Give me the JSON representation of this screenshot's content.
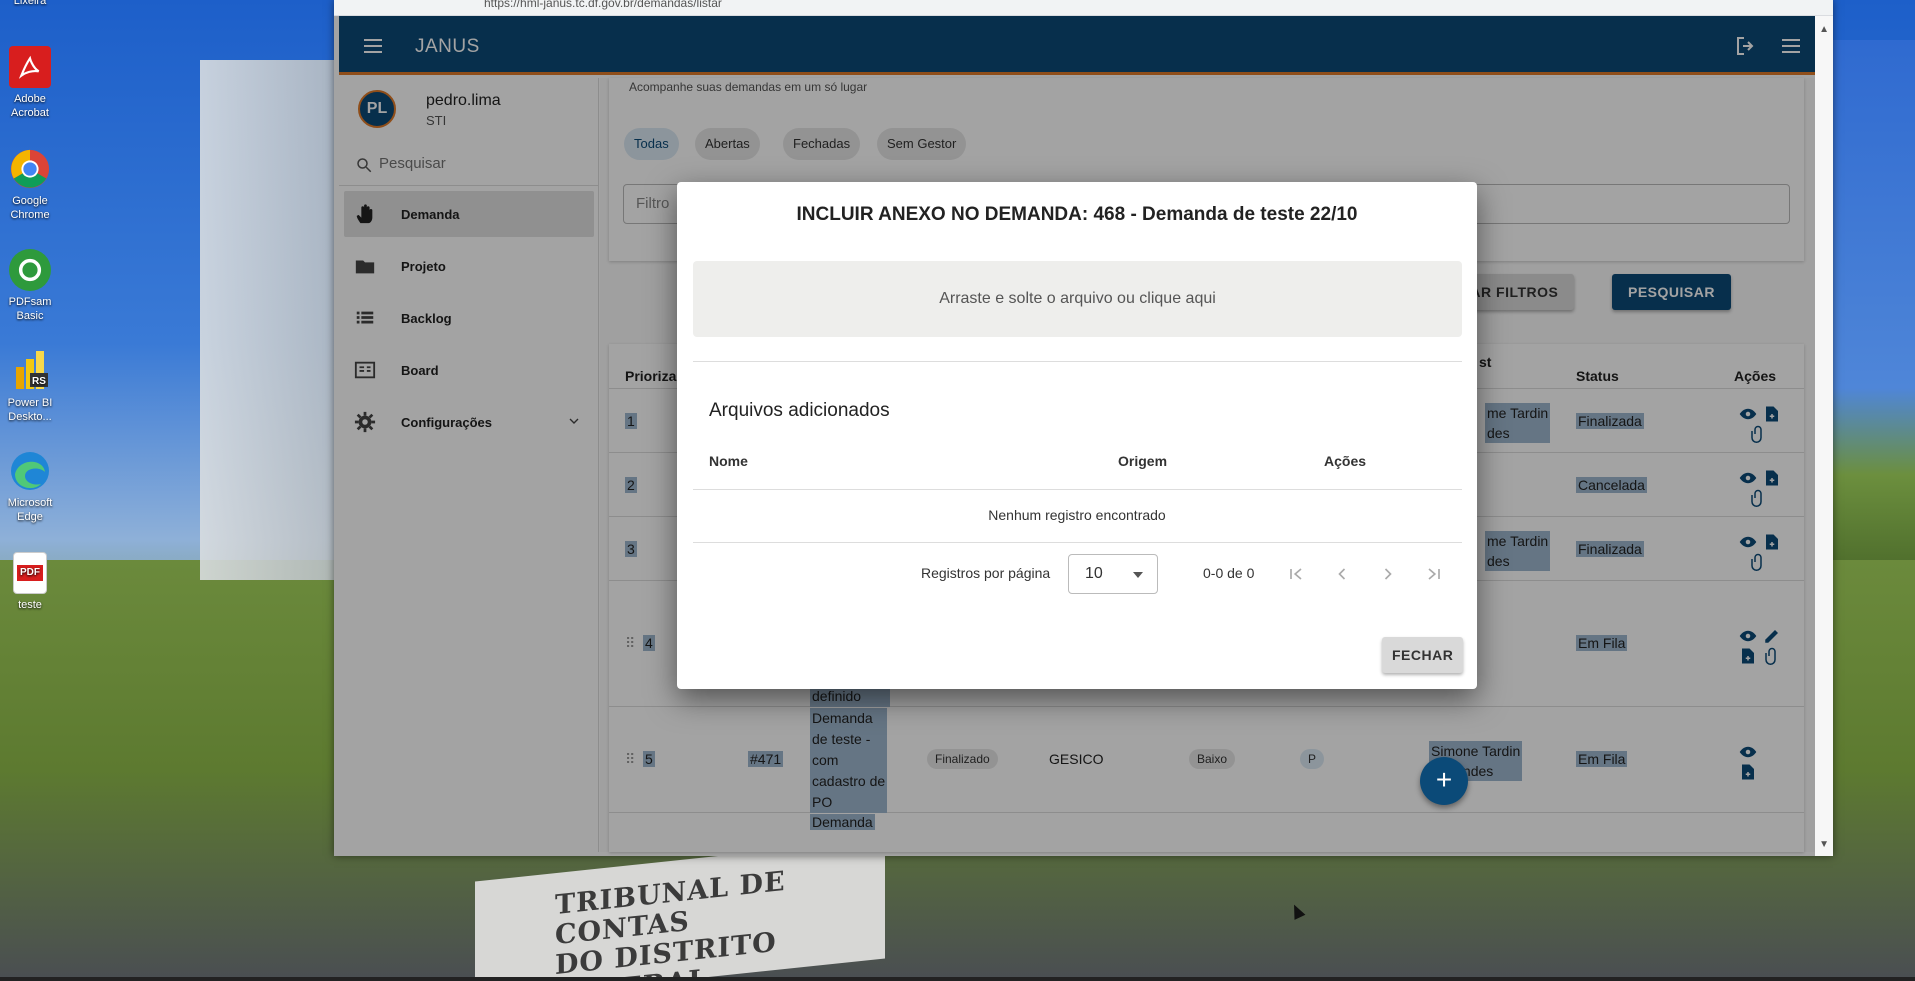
{
  "desktop": {
    "icons": [
      {
        "label": "Lixeira",
        "icon": "trash-icon",
        "color": "#2b6cc4"
      },
      {
        "label": "Adobe Acrobat",
        "icon": "adobe-acrobat-icon",
        "color": "#d81e1e"
      },
      {
        "label": "Google Chrome",
        "icon": "chrome-icon",
        "color": "#34a853"
      },
      {
        "label": "PDFsam Basic",
        "icon": "pdfsam-icon",
        "color": "#2e9a3c"
      },
      {
        "label": "Power BI Deskto...",
        "icon": "powerbi-icon",
        "color": "#f2c811"
      },
      {
        "label": "Microsoft Edge",
        "icon": "edge-icon",
        "color": "#1f86d6"
      },
      {
        "label": "teste",
        "icon": "pdf-file-icon",
        "color": "#d81e1e"
      }
    ],
    "sign_line1": "TRIBUNAL DE CONTAS",
    "sign_line2": "DO DISTRITO FEDERAL"
  },
  "browser": {
    "url": "https://hml-janus.tc.df.gov.br/demandas/listar"
  },
  "header": {
    "title": "JANUS",
    "menu_icon": "hamburger-icon",
    "logout_icon": "logout-icon",
    "more_icon": "hamburger-icon"
  },
  "sidebar": {
    "avatar": "PL",
    "user_name": "pedro.lima",
    "user_dept": "STI",
    "search_placeholder": "Pesquisar",
    "items": [
      {
        "label": "Demanda",
        "icon": "hand-icon",
        "active": true
      },
      {
        "label": "Projeto",
        "icon": "folder-icon",
        "active": false
      },
      {
        "label": "Backlog",
        "icon": "list-icon",
        "active": false
      },
      {
        "label": "Board",
        "icon": "board-icon",
        "active": false
      },
      {
        "label": "Configurações",
        "icon": "gear-icon",
        "active": false
      }
    ]
  },
  "main": {
    "subtitle": "Acompanhe suas demandas em um só lugar",
    "chips": [
      "Todas",
      "Abertas",
      "Fechadas",
      "Sem Gestor"
    ],
    "filter_placeholder": "Filtro",
    "clear_label": "LIMPAR FILTROS",
    "search_label": "PESQUISAR",
    "table": {
      "headers": [
        "Priorizaç",
        "st",
        "Status",
        "Ações"
      ],
      "rows": [
        {
          "prio": "1",
          "gestor": "me Tardin\ndes",
          "status": "Finalizada"
        },
        {
          "prio": "2",
          "gestor": "",
          "status": "Cancelada"
        },
        {
          "prio": "3",
          "gestor": "me Tardin\ndes",
          "status": "Finalizada"
        },
        {
          "prio": "4",
          "extra": "responsável\ndefinido",
          "gestor": "",
          "status": "Em Fila"
        },
        {
          "prio": "5",
          "id": "#471",
          "desc": "Demanda\nde teste -\ncom\ncadastro de\nPO",
          "situacao": "Finalizado",
          "area": "GESICO",
          "prioridade": "Baixo",
          "po": "P",
          "gestor": "Simone Tardin\nFagundes",
          "status": "Em Fila"
        }
      ],
      "trailing_text": "Demanda"
    },
    "fab": "+"
  },
  "dialog": {
    "title": "INCLUIR ANEXO NO DEMANDA: 468 - Demanda de teste 22/10",
    "dropzone": "Arraste e solte o arquivo ou clique aqui",
    "files_title": "Arquivos adicionados",
    "columns": [
      "Nome",
      "Origem",
      "Ações"
    ],
    "empty": "Nenhum registro encontrado",
    "per_page_label": "Registros por página",
    "per_page_value": "10",
    "range": "0-0 de 0",
    "close_label": "FECHAR"
  }
}
